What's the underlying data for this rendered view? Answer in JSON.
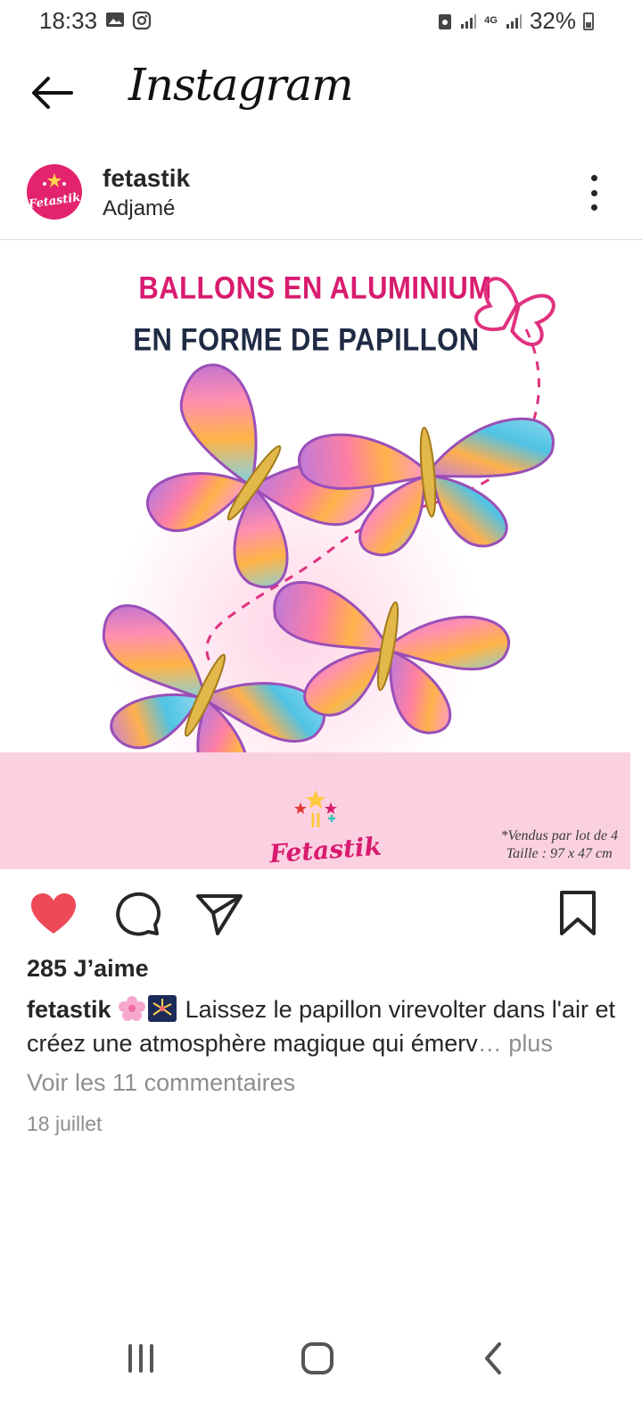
{
  "status_bar": {
    "time": "18:33",
    "battery": "32%",
    "network": "4G"
  },
  "header": {
    "title": "Instagram"
  },
  "post": {
    "username": "fetastik",
    "location": "Adjamé",
    "avatar_text": "Fetastik",
    "image": {
      "headline_line1": "BALLONS EN ALUMINIUM",
      "headline_line2": "EN FORME DE PAPILLON",
      "brand": "Fetastik",
      "note_line1": "*Vendus par lot de 4",
      "note_line2": "Taille : 97 x 47 cm"
    },
    "likes": "285 J’aime",
    "caption_user": "fetastik",
    "caption_text": "Laissez le papillon virevolter dans l'air et créez une atmosphère magique qui émerv",
    "caption_ellipsis": "…",
    "caption_more": "plus",
    "comments_link": "Voir les 11 commentaires",
    "date": "18 juillet"
  },
  "colors": {
    "like_red": "#ed4956",
    "brand_pink": "#d81b6f",
    "band_pink": "#fbd1e2",
    "headline_navy": "#1f2a44",
    "muted_gray": "#8e8e8e"
  },
  "icons": {
    "back": "arrow-left-icon",
    "more": "three-dots-vertical-icon",
    "like": "heart-filled-icon",
    "comment": "comment-bubble-icon",
    "share": "paper-plane-icon",
    "save": "bookmark-icon",
    "nav_recents": "recents-icon",
    "nav_home": "home-icon",
    "nav_back": "nav-back-icon"
  }
}
